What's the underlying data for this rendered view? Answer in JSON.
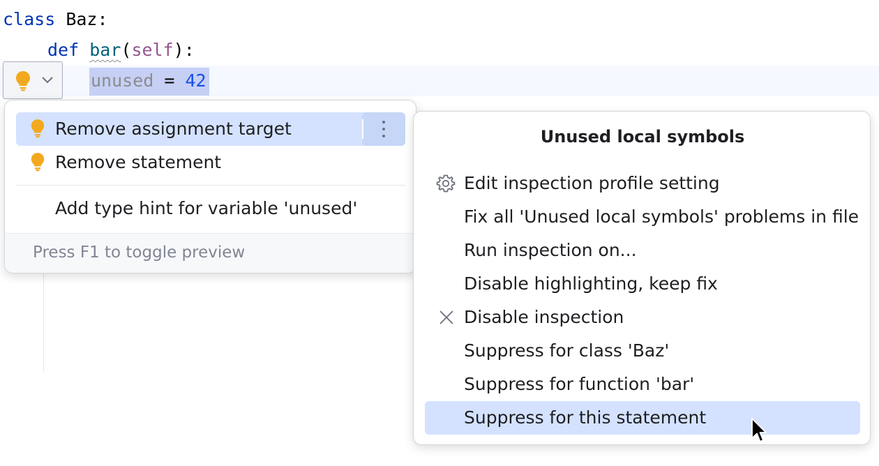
{
  "editor": {
    "line1": {
      "kw": "class",
      "name": " Baz:"
    },
    "line2": {
      "kw": "def",
      "fn": "bar",
      "open": "(",
      "self": "self",
      "close": "):"
    },
    "line3": {
      "var": "unused",
      "op": " = ",
      "num": "42"
    }
  },
  "intentions": {
    "items": [
      {
        "label": "Remove assignment target",
        "icon": "bulb-icon"
      },
      {
        "label": "Remove statement",
        "icon": "bulb-icon"
      },
      {
        "label": "Add type hint for variable 'unused'"
      }
    ],
    "footer": "Press F1 to toggle preview"
  },
  "submenu": {
    "title": "Unused local symbols",
    "items": [
      {
        "label": "Edit inspection profile setting",
        "icon": "gear-icon"
      },
      {
        "label": "Fix all 'Unused local symbols' problems in file"
      },
      {
        "label": "Run inspection on..."
      },
      {
        "label": "Disable highlighting, keep fix"
      },
      {
        "label": "Disable inspection",
        "icon": "close-icon"
      },
      {
        "label": "Suppress for class 'Baz'"
      },
      {
        "label": "Suppress for function 'bar'"
      },
      {
        "label": "Suppress for this statement"
      }
    ]
  },
  "colors": {
    "keyword": "#0033b3",
    "function": "#00627a",
    "self": "#94558d",
    "number": "#1750eb",
    "unused": "#8c8c8c",
    "selection": "#d4e2ff",
    "bulb": "#f2a91e"
  }
}
